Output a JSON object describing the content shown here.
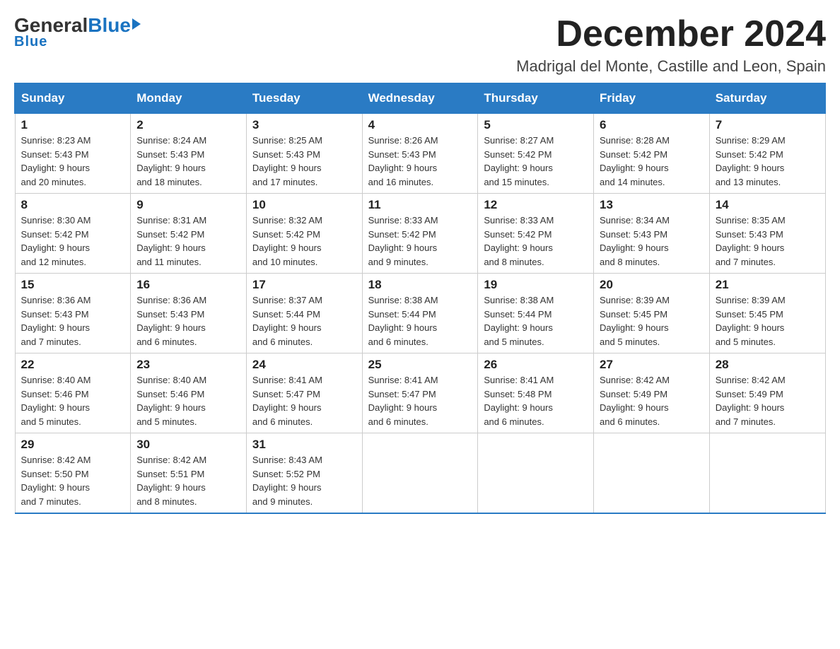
{
  "header": {
    "logo_general": "General",
    "logo_blue": "Blue",
    "month_title": "December 2024",
    "location": "Madrigal del Monte, Castille and Leon, Spain"
  },
  "days_of_week": [
    "Sunday",
    "Monday",
    "Tuesday",
    "Wednesday",
    "Thursday",
    "Friday",
    "Saturday"
  ],
  "weeks": [
    [
      {
        "day": "1",
        "sunrise": "8:23 AM",
        "sunset": "5:43 PM",
        "daylight": "9 hours and 20 minutes."
      },
      {
        "day": "2",
        "sunrise": "8:24 AM",
        "sunset": "5:43 PM",
        "daylight": "9 hours and 18 minutes."
      },
      {
        "day": "3",
        "sunrise": "8:25 AM",
        "sunset": "5:43 PM",
        "daylight": "9 hours and 17 minutes."
      },
      {
        "day": "4",
        "sunrise": "8:26 AM",
        "sunset": "5:43 PM",
        "daylight": "9 hours and 16 minutes."
      },
      {
        "day": "5",
        "sunrise": "8:27 AM",
        "sunset": "5:42 PM",
        "daylight": "9 hours and 15 minutes."
      },
      {
        "day": "6",
        "sunrise": "8:28 AM",
        "sunset": "5:42 PM",
        "daylight": "9 hours and 14 minutes."
      },
      {
        "day": "7",
        "sunrise": "8:29 AM",
        "sunset": "5:42 PM",
        "daylight": "9 hours and 13 minutes."
      }
    ],
    [
      {
        "day": "8",
        "sunrise": "8:30 AM",
        "sunset": "5:42 PM",
        "daylight": "9 hours and 12 minutes."
      },
      {
        "day": "9",
        "sunrise": "8:31 AM",
        "sunset": "5:42 PM",
        "daylight": "9 hours and 11 minutes."
      },
      {
        "day": "10",
        "sunrise": "8:32 AM",
        "sunset": "5:42 PM",
        "daylight": "9 hours and 10 minutes."
      },
      {
        "day": "11",
        "sunrise": "8:33 AM",
        "sunset": "5:42 PM",
        "daylight": "9 hours and 9 minutes."
      },
      {
        "day": "12",
        "sunrise": "8:33 AM",
        "sunset": "5:42 PM",
        "daylight": "9 hours and 8 minutes."
      },
      {
        "day": "13",
        "sunrise": "8:34 AM",
        "sunset": "5:43 PM",
        "daylight": "9 hours and 8 minutes."
      },
      {
        "day": "14",
        "sunrise": "8:35 AM",
        "sunset": "5:43 PM",
        "daylight": "9 hours and 7 minutes."
      }
    ],
    [
      {
        "day": "15",
        "sunrise": "8:36 AM",
        "sunset": "5:43 PM",
        "daylight": "9 hours and 7 minutes."
      },
      {
        "day": "16",
        "sunrise": "8:36 AM",
        "sunset": "5:43 PM",
        "daylight": "9 hours and 6 minutes."
      },
      {
        "day": "17",
        "sunrise": "8:37 AM",
        "sunset": "5:44 PM",
        "daylight": "9 hours and 6 minutes."
      },
      {
        "day": "18",
        "sunrise": "8:38 AM",
        "sunset": "5:44 PM",
        "daylight": "9 hours and 6 minutes."
      },
      {
        "day": "19",
        "sunrise": "8:38 AM",
        "sunset": "5:44 PM",
        "daylight": "9 hours and 5 minutes."
      },
      {
        "day": "20",
        "sunrise": "8:39 AM",
        "sunset": "5:45 PM",
        "daylight": "9 hours and 5 minutes."
      },
      {
        "day": "21",
        "sunrise": "8:39 AM",
        "sunset": "5:45 PM",
        "daylight": "9 hours and 5 minutes."
      }
    ],
    [
      {
        "day": "22",
        "sunrise": "8:40 AM",
        "sunset": "5:46 PM",
        "daylight": "9 hours and 5 minutes."
      },
      {
        "day": "23",
        "sunrise": "8:40 AM",
        "sunset": "5:46 PM",
        "daylight": "9 hours and 5 minutes."
      },
      {
        "day": "24",
        "sunrise": "8:41 AM",
        "sunset": "5:47 PM",
        "daylight": "9 hours and 6 minutes."
      },
      {
        "day": "25",
        "sunrise": "8:41 AM",
        "sunset": "5:47 PM",
        "daylight": "9 hours and 6 minutes."
      },
      {
        "day": "26",
        "sunrise": "8:41 AM",
        "sunset": "5:48 PM",
        "daylight": "9 hours and 6 minutes."
      },
      {
        "day": "27",
        "sunrise": "8:42 AM",
        "sunset": "5:49 PM",
        "daylight": "9 hours and 6 minutes."
      },
      {
        "day": "28",
        "sunrise": "8:42 AM",
        "sunset": "5:49 PM",
        "daylight": "9 hours and 7 minutes."
      }
    ],
    [
      {
        "day": "29",
        "sunrise": "8:42 AM",
        "sunset": "5:50 PM",
        "daylight": "9 hours and 7 minutes."
      },
      {
        "day": "30",
        "sunrise": "8:42 AM",
        "sunset": "5:51 PM",
        "daylight": "9 hours and 8 minutes."
      },
      {
        "day": "31",
        "sunrise": "8:43 AM",
        "sunset": "5:52 PM",
        "daylight": "9 hours and 9 minutes."
      },
      null,
      null,
      null,
      null
    ]
  ]
}
